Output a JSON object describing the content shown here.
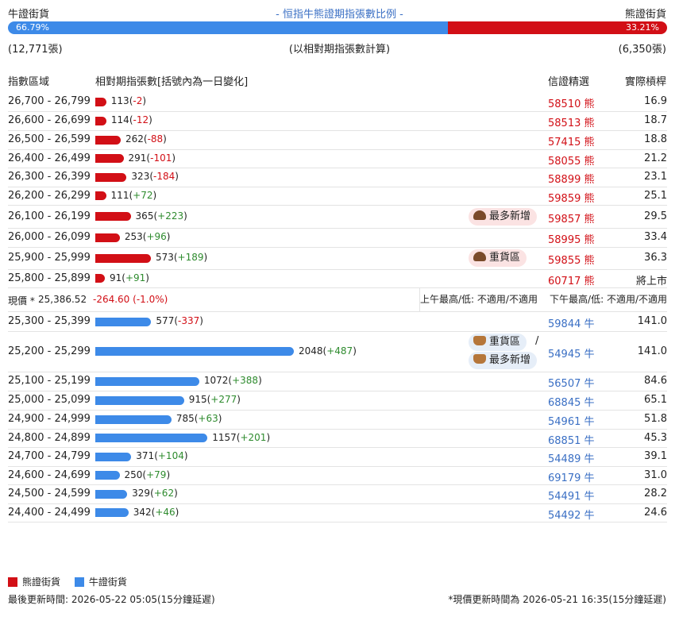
{
  "header": {
    "bull_label": "牛證街貨",
    "title": "- 恒指牛熊證期指張數比例 -",
    "bear_label": "熊證街貨",
    "bull_pct": "66.79%",
    "bear_pct": "33.21%",
    "bull_fraction": 0.6679,
    "bull_count": "(12,771張)",
    "note": "(以相對期指張數計算)",
    "bear_count": "(6,350張)"
  },
  "columns": {
    "range": "指數區域",
    "qty": "相對期指張數[括號內為一日變化]",
    "pick": "信證精選",
    "leverage": "實際槓桿"
  },
  "colors": {
    "bear": "#d20f16",
    "bull": "#3d8ae8",
    "up": "#2e8b2e"
  },
  "bear_rows": [
    {
      "range": "26,700 - 26,799",
      "qty": "113",
      "change": "-2",
      "code": "58510",
      "type": "熊",
      "lev": "16.9",
      "value": 113
    },
    {
      "range": "26,600 - 26,699",
      "qty": "114",
      "change": "-12",
      "code": "58513",
      "type": "熊",
      "lev": "18.7",
      "value": 114
    },
    {
      "range": "26,500 - 26,599",
      "qty": "262",
      "change": "-88",
      "code": "57415",
      "type": "熊",
      "lev": "18.8",
      "value": 262
    },
    {
      "range": "26,400 - 26,499",
      "qty": "291",
      "change": "-101",
      "code": "58055",
      "type": "熊",
      "lev": "21.2",
      "value": 291
    },
    {
      "range": "26,300 - 26,399",
      "qty": "323",
      "change": "-184",
      "code": "58899",
      "type": "熊",
      "lev": "23.1",
      "value": 323
    },
    {
      "range": "26,200 - 26,299",
      "qty": "111",
      "change": "+72",
      "code": "59859",
      "type": "熊",
      "lev": "25.1",
      "value": 111
    },
    {
      "range": "26,100 - 26,199",
      "qty": "365",
      "change": "+223",
      "code": "59857",
      "type": "熊",
      "lev": "29.5",
      "value": 365,
      "badge": "最多新增"
    },
    {
      "range": "26,000 - 26,099",
      "qty": "253",
      "change": "+96",
      "code": "58995",
      "type": "熊",
      "lev": "33.4",
      "value": 253
    },
    {
      "range": "25,900 - 25,999",
      "qty": "573",
      "change": "+189",
      "code": "59855",
      "type": "熊",
      "lev": "36.3",
      "value": 573,
      "badge": "重貨區"
    },
    {
      "range": "25,800 - 25,899",
      "qty": "91",
      "change": "+91",
      "code": "60717",
      "type": "熊",
      "lev": "將上市",
      "value": 91
    }
  ],
  "current": {
    "label": "現價 *",
    "price": "25,386.52",
    "change": "-264.60 (-1.0%)",
    "am": "上午最高/低: 不適用/不適用",
    "pm": "下午最高/低: 不適用/不適用"
  },
  "bull_rows": [
    {
      "range": "25,300 - 25,399",
      "qty": "577",
      "change": "-337",
      "code": "59844",
      "type": "牛",
      "lev": "141.0",
      "value": 577
    },
    {
      "range": "25,200 - 25,299",
      "qty": "2048",
      "change": "+487",
      "code": "54945",
      "type": "牛",
      "lev": "141.0",
      "value": 2048,
      "badge": "重貨區",
      "badge2": "最多新增",
      "sep": "/"
    },
    {
      "range": "25,100 - 25,199",
      "qty": "1072",
      "change": "+388",
      "code": "56507",
      "type": "牛",
      "lev": "84.6",
      "value": 1072
    },
    {
      "range": "25,000 - 25,099",
      "qty": "915",
      "change": "+277",
      "code": "68845",
      "type": "牛",
      "lev": "65.1",
      "value": 915
    },
    {
      "range": "24,900 - 24,999",
      "qty": "785",
      "change": "+63",
      "code": "54961",
      "type": "牛",
      "lev": "51.8",
      "value": 785
    },
    {
      "range": "24,800 - 24,899",
      "qty": "1157",
      "change": "+201",
      "code": "68851",
      "type": "牛",
      "lev": "45.3",
      "value": 1157
    },
    {
      "range": "24,700 - 24,799",
      "qty": "371",
      "change": "+104",
      "code": "54489",
      "type": "牛",
      "lev": "39.1",
      "value": 371
    },
    {
      "range": "24,600 - 24,699",
      "qty": "250",
      "change": "+79",
      "code": "69179",
      "type": "牛",
      "lev": "31.0",
      "value": 250
    },
    {
      "range": "24,500 - 24,599",
      "qty": "329",
      "change": "+62",
      "code": "54491",
      "type": "牛",
      "lev": "28.2",
      "value": 329
    },
    {
      "range": "24,400 - 24,499",
      "qty": "342",
      "change": "+46",
      "code": "54492",
      "type": "牛",
      "lev": "24.6",
      "value": 342
    }
  ],
  "legend": {
    "bear": "熊證街貨",
    "bull": "牛證街貨"
  },
  "footer": {
    "left": "最後更新時間: 2026-05-22 05:05(15分鐘延遲)",
    "right": "*現價更新時間為 2026-05-21 16:35(15分鐘延遲)"
  }
}
